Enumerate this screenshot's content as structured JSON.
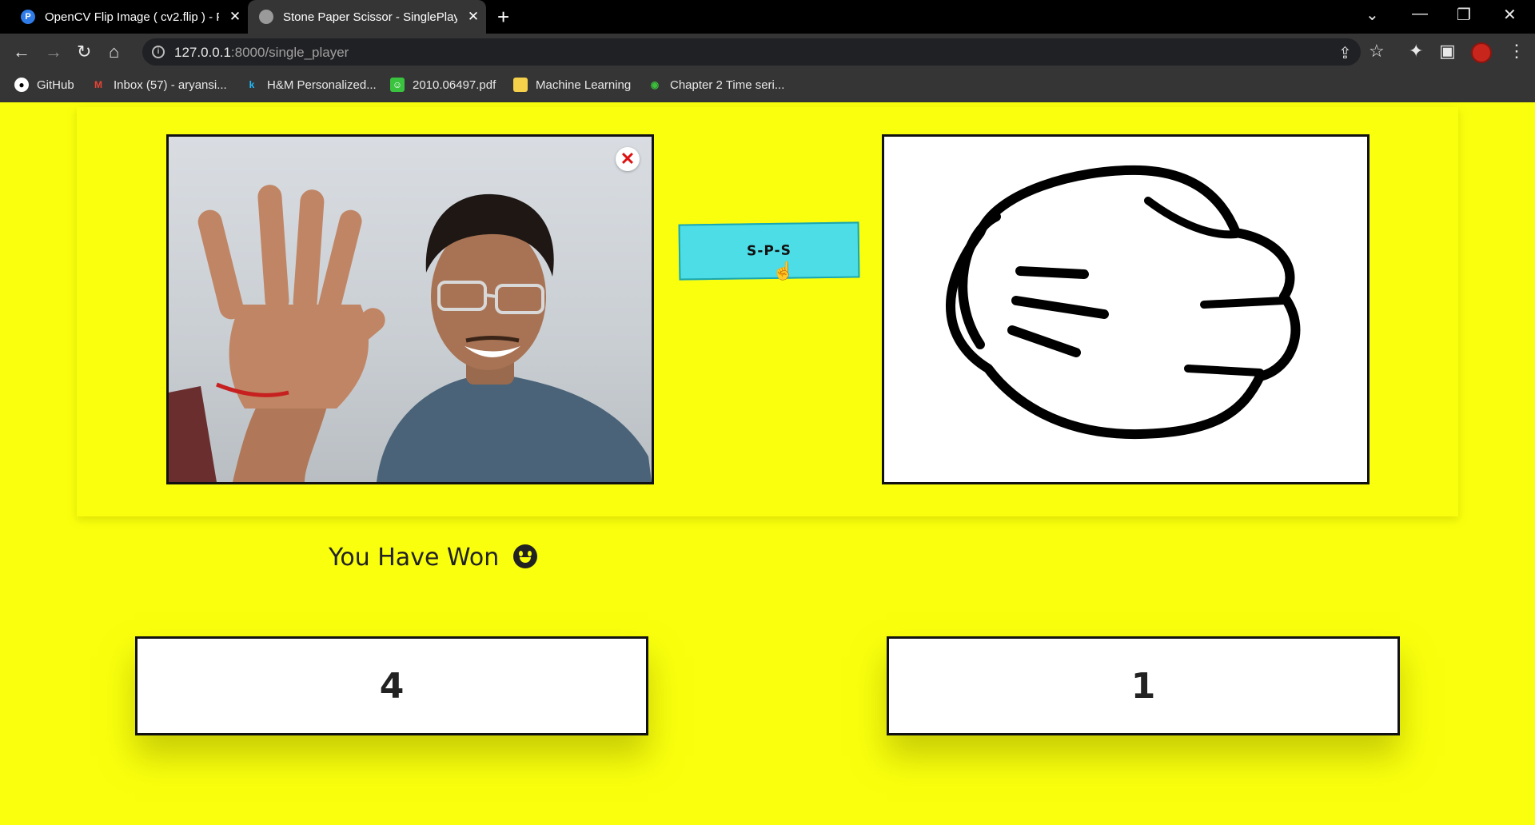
{
  "tabs": [
    {
      "title": "OpenCV Flip Image ( cv2.flip ) - P",
      "favicon": "pyimagesearch-icon"
    },
    {
      "title": "Stone Paper Scissor - SinglePlaye",
      "favicon": "globe-icon"
    }
  ],
  "address_bar": {
    "host": "127.0.0.1",
    "path": ":8000/single_player"
  },
  "bookmarks": [
    {
      "label": "GitHub"
    },
    {
      "label": "Inbox (57) - aryansi..."
    },
    {
      "label": "H&M Personalized..."
    },
    {
      "label": "2010.06497.pdf"
    },
    {
      "label": "Machine Learning"
    },
    {
      "label": "Chapter 2 Time seri..."
    }
  ],
  "game": {
    "play_button_label": "S-P-S",
    "close_symbol": "✕",
    "result_text": "You Have Won",
    "player_score": "4",
    "computer_score": "1",
    "computer_choice": "stone"
  },
  "colors": {
    "background": "#f9ff0c",
    "button": "#4ddde6"
  }
}
